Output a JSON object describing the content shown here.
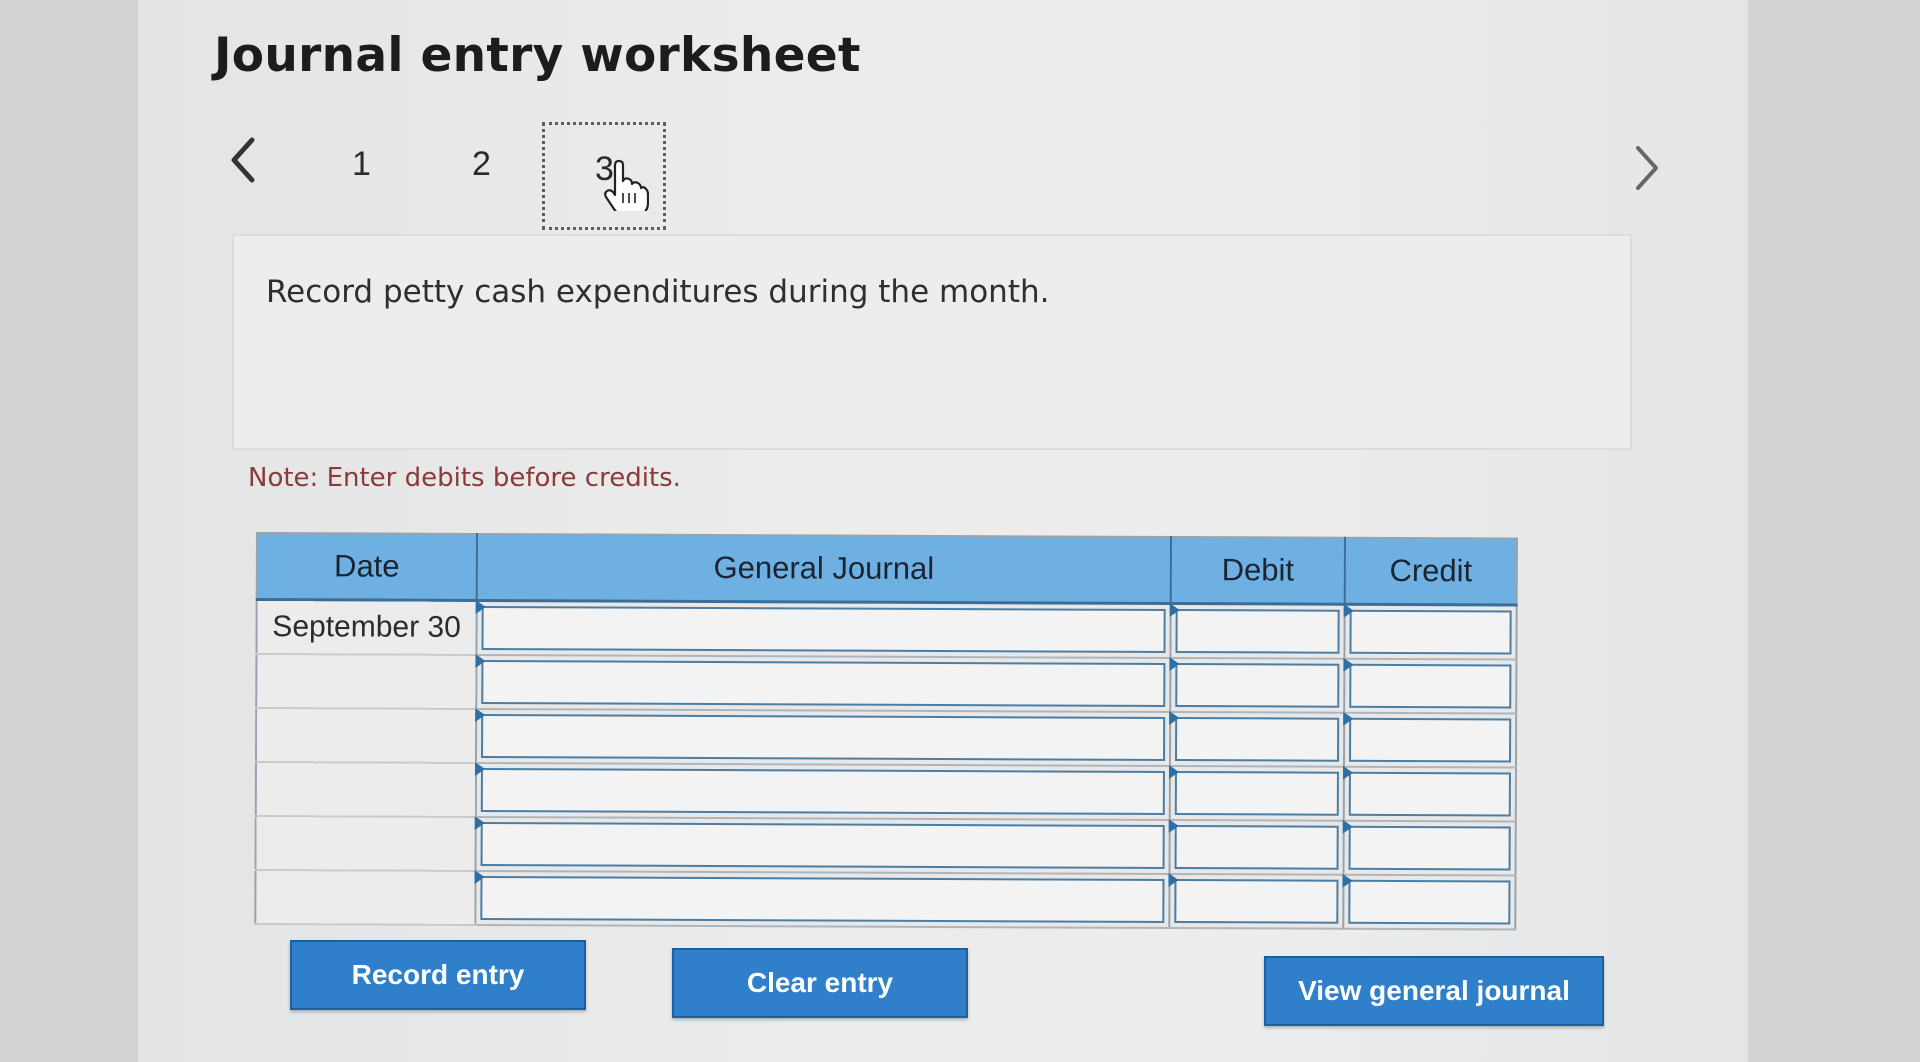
{
  "page": {
    "title": "Journal entry worksheet"
  },
  "pagination": {
    "prev_icon": "chevron-left-icon",
    "next_icon": "chevron-right-icon",
    "steps": [
      {
        "label": "1",
        "active": false
      },
      {
        "label": "2",
        "active": false
      },
      {
        "label": "3",
        "active": true
      }
    ],
    "cursor_icon": "hand-pointer-icon"
  },
  "prompt": {
    "text": "Record petty cash expenditures during the month."
  },
  "note": {
    "text": "Note: Enter debits before credits."
  },
  "journal": {
    "headers": {
      "date": "Date",
      "general_journal": "General Journal",
      "debit": "Debit",
      "credit": "Credit"
    },
    "rows": [
      {
        "date": "September 30",
        "account": "",
        "debit": "",
        "credit": ""
      },
      {
        "date": "",
        "account": "",
        "debit": "",
        "credit": ""
      },
      {
        "date": "",
        "account": "",
        "debit": "",
        "credit": ""
      },
      {
        "date": "",
        "account": "",
        "debit": "",
        "credit": ""
      },
      {
        "date": "",
        "account": "",
        "debit": "",
        "credit": ""
      },
      {
        "date": "",
        "account": "",
        "debit": "",
        "credit": ""
      }
    ]
  },
  "buttons": {
    "record": "Record entry",
    "clear": "Clear entry",
    "view": "View general journal"
  },
  "colors": {
    "header_bg": "#6fb0e3",
    "button_bg": "#2f7fcb",
    "note_text": "#8c3b3b"
  }
}
